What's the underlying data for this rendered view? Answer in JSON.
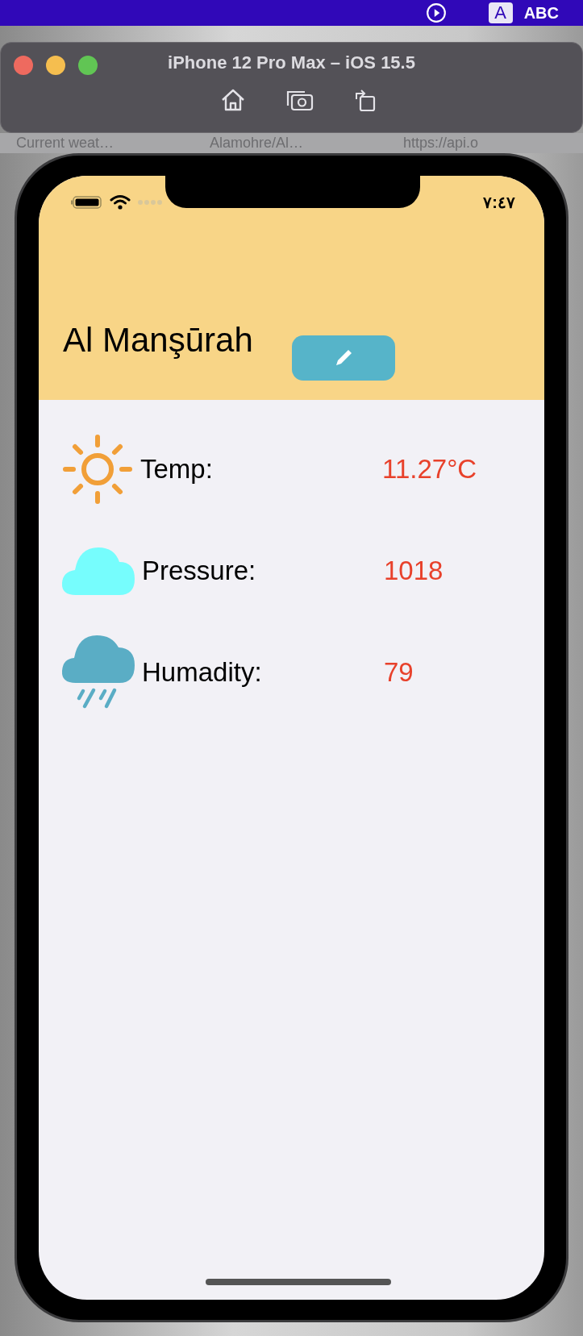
{
  "menu_bar": {
    "input_source": "A",
    "input_label": "ABC"
  },
  "simulator": {
    "title": "iPhone 12 Pro Max – iOS 15.5"
  },
  "browser_tabs": [
    {
      "label": "Current weat…"
    },
    {
      "label": "Alamohre/Al…"
    },
    {
      "label": "https://api.o"
    }
  ],
  "status_bar": {
    "time": "٧:٤٧"
  },
  "header": {
    "city": "Al Manşūrah"
  },
  "readings": [
    {
      "kind": "sun",
      "label": "Temp:",
      "value": "11.27°C"
    },
    {
      "kind": "cloud",
      "label": "Pressure:",
      "value": "1018"
    },
    {
      "kind": "rain",
      "label": "Humadity:",
      "value": "79"
    }
  ]
}
